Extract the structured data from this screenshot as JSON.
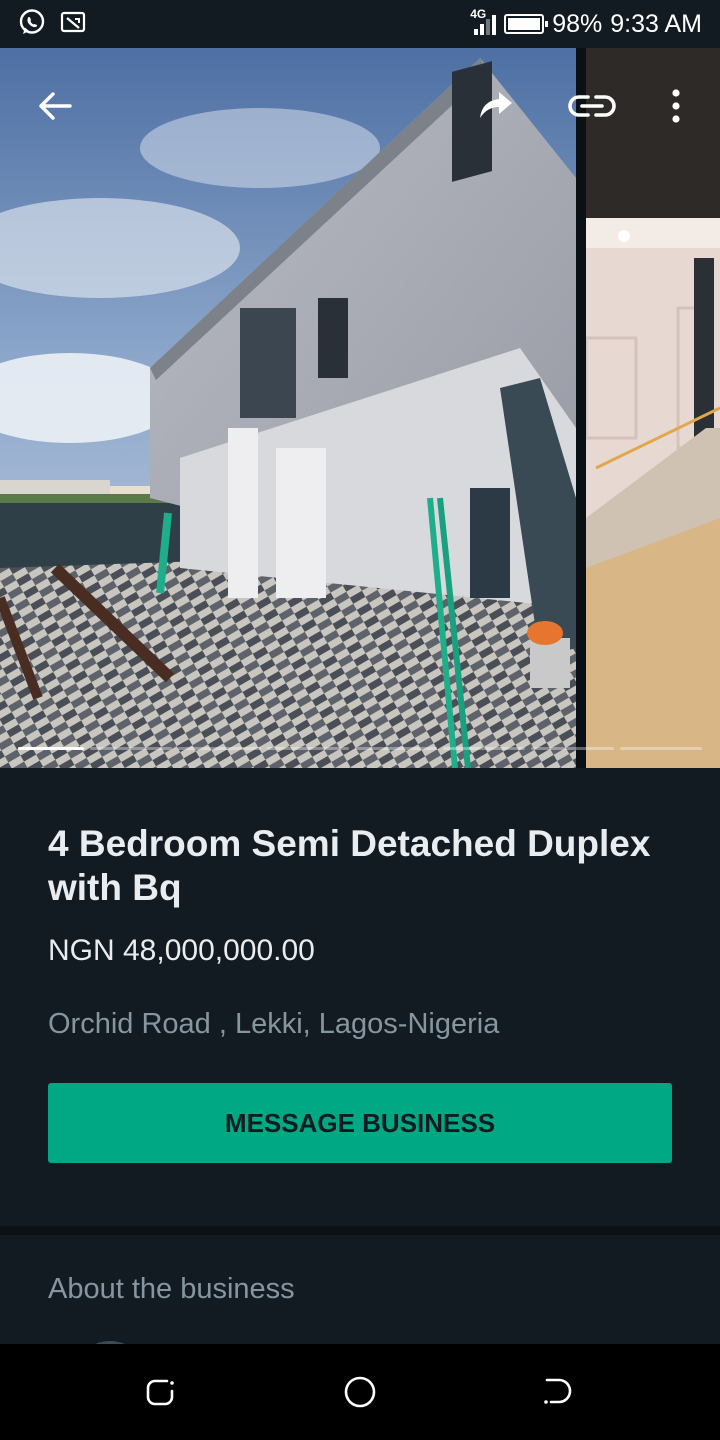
{
  "status_bar": {
    "network": "4G",
    "battery": "98%",
    "time": "9:33 AM"
  },
  "carousel": {
    "photo_count": 8,
    "current_index": 1
  },
  "listing": {
    "title": "4 Bedroom Semi Detached Duplex with Bq",
    "price": "NGN 48,000,000.00",
    "location": "Orchid Road , Lekki, Lagos-Nigeria",
    "message_button": "MESSAGE BUSINESS"
  },
  "about": {
    "title": "About the business"
  },
  "colors": {
    "background": "#121b22",
    "accent": "#00a884",
    "primary_text": "#e9edef",
    "secondary_text": "#8696a0"
  },
  "icons": [
    "whatsapp-icon",
    "cast-icon",
    "signal-icon",
    "battery-icon",
    "back-arrow-icon",
    "share-icon",
    "link-icon",
    "more-vert-icon",
    "recent-apps-icon",
    "home-icon",
    "back-icon"
  ]
}
